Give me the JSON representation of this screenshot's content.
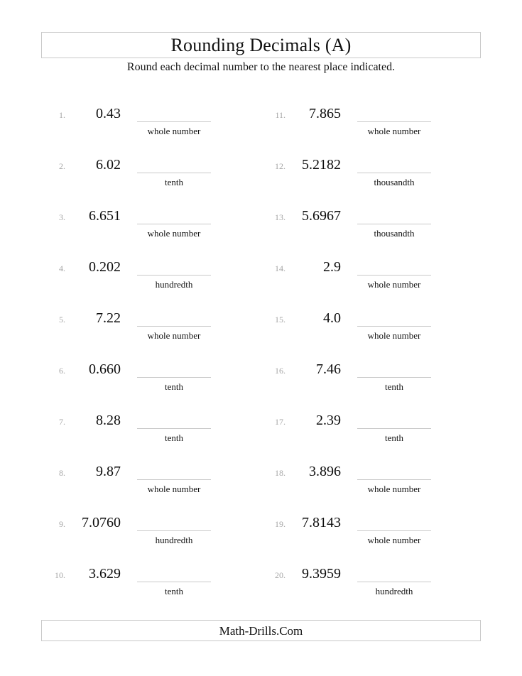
{
  "header": {
    "title": "Rounding Decimals (A)",
    "subtitle": "Round each decimal number to the nearest place indicated."
  },
  "footer": {
    "site": "Math-Drills.Com"
  },
  "colors": {
    "text": "#111111",
    "index": "#a6a6a6",
    "rule": "#c9c9c9",
    "border": "#c8c8c8",
    "page_background": "#ffffff"
  },
  "problems": {
    "left_column": [
      {
        "index": "1.",
        "number": "0.43",
        "place": "whole number"
      },
      {
        "index": "2.",
        "number": "6.02",
        "place": "tenth"
      },
      {
        "index": "3.",
        "number": "6.651",
        "place": "whole number"
      },
      {
        "index": "4.",
        "number": "0.202",
        "place": "hundredth"
      },
      {
        "index": "5.",
        "number": "7.22",
        "place": "whole number"
      },
      {
        "index": "6.",
        "number": "0.660",
        "place": "tenth"
      },
      {
        "index": "7.",
        "number": "8.28",
        "place": "tenth"
      },
      {
        "index": "8.",
        "number": "9.87",
        "place": "whole number"
      },
      {
        "index": "9.",
        "number": "7.0760",
        "place": "hundredth"
      },
      {
        "index": "10.",
        "number": "3.629",
        "place": "tenth"
      }
    ],
    "right_column": [
      {
        "index": "11.",
        "number": "7.865",
        "place": "whole number"
      },
      {
        "index": "12.",
        "number": "5.2182",
        "place": "thousandth"
      },
      {
        "index": "13.",
        "number": "5.6967",
        "place": "thousandth"
      },
      {
        "index": "14.",
        "number": "2.9",
        "place": "whole number"
      },
      {
        "index": "15.",
        "number": "4.0",
        "place": "whole number"
      },
      {
        "index": "16.",
        "number": "7.46",
        "place": "tenth"
      },
      {
        "index": "17.",
        "number": "2.39",
        "place": "tenth"
      },
      {
        "index": "18.",
        "number": "3.896",
        "place": "whole number"
      },
      {
        "index": "19.",
        "number": "7.8143",
        "place": "whole number"
      },
      {
        "index": "20.",
        "number": "9.3959",
        "place": "hundredth"
      }
    ]
  }
}
